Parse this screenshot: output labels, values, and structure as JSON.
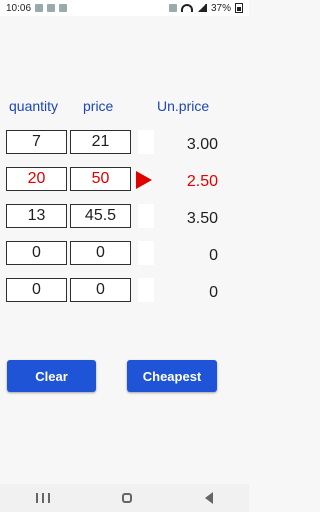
{
  "status_bar": {
    "time": "10:06",
    "battery": "37%"
  },
  "headers": {
    "quantity": "quantity",
    "price": "price",
    "unit_price": "Un.price"
  },
  "rows": [
    {
      "quantity": "7",
      "price": "21",
      "unit_price": "3.00",
      "highlight": false
    },
    {
      "quantity": "20",
      "price": "50",
      "unit_price": "2.50",
      "highlight": true
    },
    {
      "quantity": "13",
      "price": "45.5",
      "unit_price": "3.50",
      "highlight": false
    },
    {
      "quantity": "0",
      "price": "0",
      "unit_price": "0",
      "highlight": false
    },
    {
      "quantity": "0",
      "price": "0",
      "unit_price": "0",
      "highlight": false
    }
  ],
  "buttons": {
    "clear": "Clear",
    "cheapest": "Cheapest"
  },
  "colors": {
    "accent_blue": "#1f54d6",
    "header_blue": "#1d47b8",
    "highlight_red": "#e10000"
  },
  "icons": {
    "status_left": [
      "notification-icon",
      "notification-icon",
      "notification-icon"
    ],
    "status_right": [
      "mute-icon",
      "wifi-icon",
      "signal-icon",
      "battery-icon"
    ],
    "nav": [
      "recent-apps-icon",
      "home-icon",
      "back-icon"
    ]
  }
}
